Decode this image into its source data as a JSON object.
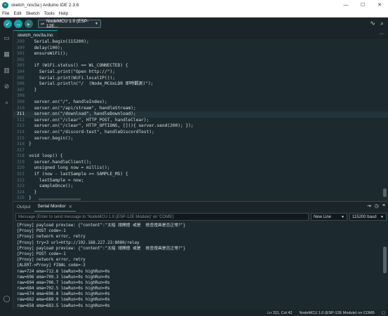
{
  "window": {
    "title": "sketch_nov3a | Arduino IDE 2.3.6",
    "controls": [
      "—",
      "☐",
      "✕"
    ]
  },
  "menu": [
    "File",
    "Edit",
    "Sketch",
    "Tools",
    "Help"
  ],
  "toolbar": {
    "board": "NodeMCU 1.0 (ESP-12E..."
  },
  "editor": {
    "tab": "sketch_nov3a.ino",
    "current_line": "311",
    "lines": [
      {
        "n": "299",
        "code": "  Serial.begin(115200);"
      },
      {
        "n": "300",
        "code": "  delay(100);"
      },
      {
        "n": "301",
        "code": "  ensureWiFi();"
      },
      {
        "n": "302",
        "code": ""
      },
      {
        "n": "303",
        "code": "  if (WiFi.status() == WL_CONNECTED) {"
      },
      {
        "n": "304",
        "code": "    Serial.print(\"Open http://\");"
      },
      {
        "n": "305",
        "code": "    Serial.print(WiFi.localIP());"
      },
      {
        "n": "306",
        "code": "    Serial.println(\"/  (Node_MCUxLDR 即時觀測)\");"
      },
      {
        "n": "307",
        "code": "  }"
      },
      {
        "n": "308",
        "code": ""
      },
      {
        "n": "309",
        "code": "  server.on(\"/\", handleIndex);"
      },
      {
        "n": "310",
        "code": "  server.on(\"/api/stream\", handleStream);"
      },
      {
        "n": "311",
        "code": "  server.on(\"/download\", handleDownload);"
      },
      {
        "n": "312",
        "code": "  server.on(\"/clear\", HTTP_POST, handleClear);"
      },
      {
        "n": "313",
        "code": "  server.on(\"/clear\", HTTP_OPTIONS, [](){ server.send(200); });"
      },
      {
        "n": "314",
        "code": "  server.on(\"/discord-test\", handleDiscordTest);"
      },
      {
        "n": "315",
        "code": "  server.begin();"
      },
      {
        "n": "316",
        "code": "}"
      },
      {
        "n": "317",
        "code": ""
      },
      {
        "n": "318",
        "code": "void loop() {"
      },
      {
        "n": "319",
        "code": "  server.handleClient();"
      },
      {
        "n": "320",
        "code": "  unsigned long now = millis();"
      },
      {
        "n": "321",
        "code": "  if (now - lastSample >= SAMPLE_MS) {"
      },
      {
        "n": "322",
        "code": "    lastSample = now;"
      },
      {
        "n": "323",
        "code": "    sampleOnce();"
      },
      {
        "n": "324",
        "code": "  }"
      },
      {
        "n": "325",
        "code": "}"
      },
      {
        "n": "326",
        "code": ""
      }
    ]
  },
  "panel": {
    "tabs": [
      "Output",
      "Serial Monitor"
    ],
    "message_placeholder": "Message (Enter to send message to 'NodeMCU 1.0 (ESP-12E Module)' on 'COM5')",
    "line_ending": "New Line",
    "baud": "115200 baud",
    "serial_lines": [
      "[Proxy] payload preview: {\"content\":\"太暗 請開燈 或是  檢查燈具是否正常?\"}",
      "[Proxy] POST code=-1",
      "[Proxy] network error, retry",
      "[Proxy] try=3 url=http://192.168.227.23:8080/relay",
      "[Proxy] payload preview: {\"content\":\"太暗 請開燈 或是  檢查燈具是否正常?\"}",
      "[Proxy] POST code=-1",
      "[Proxy] network error, retry",
      "[ALERT->Proxy] FINAL code=-3",
      "raw=724 ema=712.6 lowRun=0s highRun=0s",
      "raw=696 ema=709.3 lowRun=0s highRun=0s",
      "raw=694 ema=706.7 lowRun=0s highRun=0s",
      "raw=684 ema=702.5 lowRun=0s highRun=0s",
      "raw=674 ema=696.8 lowRun=0s highRun=0s",
      "raw=662 ema=689.9 lowRun=0s highRun=0s",
      "raw=658 ema=683.5 lowRun=0s highRun=0s"
    ]
  },
  "status": {
    "position": "Ln 311, Col 42",
    "board_port": "NodeMCU 1.0 (ESP-12E Module) on COM5"
  }
}
